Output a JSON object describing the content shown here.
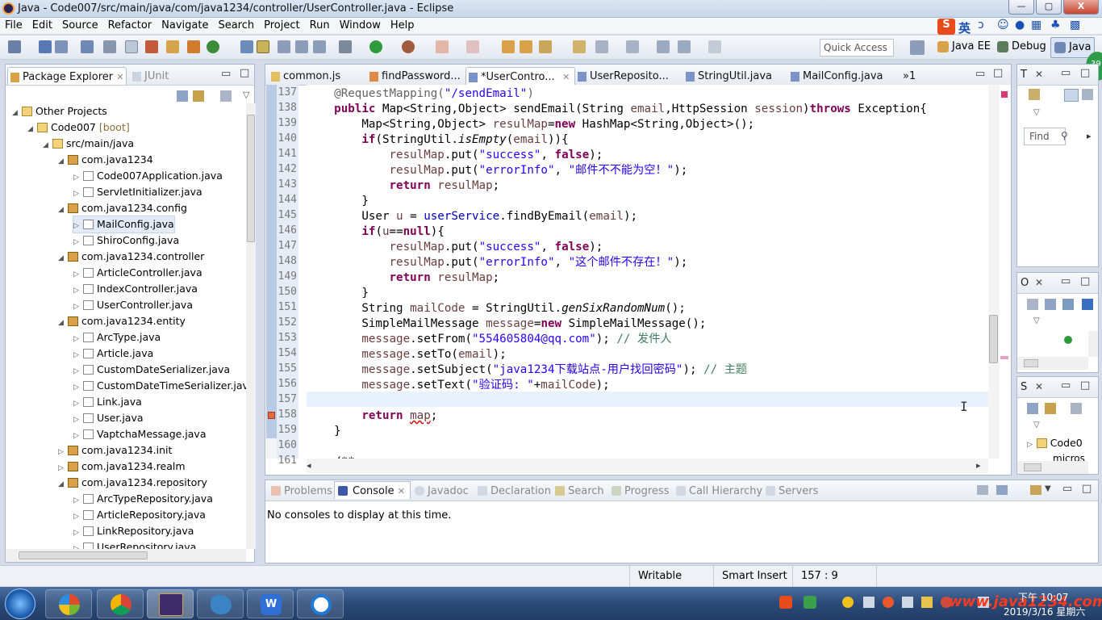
{
  "window": {
    "title": "Java - Code007/src/main/java/com/java1234/controller/UserController.java - Eclipse",
    "minimize": "—",
    "maximize": "▢",
    "close": "X"
  },
  "menu": [
    "File",
    "Edit",
    "Source",
    "Refactor",
    "Navigate",
    "Search",
    "Project",
    "Run",
    "Window",
    "Help"
  ],
  "quick_access": {
    "placeholder": "Quick Access"
  },
  "perspectives": [
    "Java EE",
    "Debug",
    "Java"
  ],
  "ime": {
    "label": "英"
  },
  "package_explorer": {
    "tabs": [
      "Package Explorer",
      "JUnit"
    ],
    "tree": [
      {
        "label": "Other Projects",
        "depth": 0,
        "twisty": "◢",
        "icon": "folder"
      },
      {
        "label": "Code007",
        "suffix": " [boot]",
        "depth": 1,
        "twisty": "◢",
        "icon": "project"
      },
      {
        "label": "src/main/java",
        "depth": 2,
        "twisty": "◢",
        "icon": "srcfolder"
      },
      {
        "label": "com.java1234",
        "depth": 3,
        "twisty": "◢",
        "icon": "package"
      },
      {
        "label": "Code007Application.java",
        "depth": 4,
        "twisty": "▷",
        "icon": "java"
      },
      {
        "label": "ServletInitializer.java",
        "depth": 4,
        "twisty": "▷",
        "icon": "java"
      },
      {
        "label": "com.java1234.config",
        "depth": 3,
        "twisty": "◢",
        "icon": "package"
      },
      {
        "label": "MailConfig.java",
        "depth": 4,
        "twisty": "▷",
        "icon": "java",
        "selected": true
      },
      {
        "label": "ShiroConfig.java",
        "depth": 4,
        "twisty": "▷",
        "icon": "java"
      },
      {
        "label": "com.java1234.controller",
        "depth": 3,
        "twisty": "◢",
        "icon": "package"
      },
      {
        "label": "ArticleController.java",
        "depth": 4,
        "twisty": "▷",
        "icon": "java"
      },
      {
        "label": "IndexController.java",
        "depth": 4,
        "twisty": "▷",
        "icon": "java"
      },
      {
        "label": "UserController.java",
        "depth": 4,
        "twisty": "▷",
        "icon": "java"
      },
      {
        "label": "com.java1234.entity",
        "depth": 3,
        "twisty": "◢",
        "icon": "package"
      },
      {
        "label": "ArcType.java",
        "depth": 4,
        "twisty": "▷",
        "icon": "java"
      },
      {
        "label": "Article.java",
        "depth": 4,
        "twisty": "▷",
        "icon": "java"
      },
      {
        "label": "CustomDateSerializer.java",
        "depth": 4,
        "twisty": "▷",
        "icon": "java"
      },
      {
        "label": "CustomDateTimeSerializer.java",
        "depth": 4,
        "twisty": "▷",
        "icon": "java"
      },
      {
        "label": "Link.java",
        "depth": 4,
        "twisty": "▷",
        "icon": "java"
      },
      {
        "label": "User.java",
        "depth": 4,
        "twisty": "▷",
        "icon": "java"
      },
      {
        "label": "VaptchaMessage.java",
        "depth": 4,
        "twisty": "▷",
        "icon": "java"
      },
      {
        "label": "com.java1234.init",
        "depth": 3,
        "twisty": "▷",
        "icon": "package"
      },
      {
        "label": "com.java1234.realm",
        "depth": 3,
        "twisty": "▷",
        "icon": "package"
      },
      {
        "label": "com.java1234.repository",
        "depth": 3,
        "twisty": "◢",
        "icon": "package"
      },
      {
        "label": "ArcTypeRepository.java",
        "depth": 4,
        "twisty": "▷",
        "icon": "java"
      },
      {
        "label": "ArticleRepository.java",
        "depth": 4,
        "twisty": "▷",
        "icon": "java"
      },
      {
        "label": "LinkRepository.java",
        "depth": 4,
        "twisty": "▷",
        "icon": "java"
      },
      {
        "label": "UserRepository.java",
        "depth": 4,
        "twisty": "▷",
        "icon": "java"
      }
    ]
  },
  "editor": {
    "tabs": [
      {
        "label": "common.js",
        "active": false,
        "icon": "js"
      },
      {
        "label": "findPassword...",
        "active": false,
        "icon": "html"
      },
      {
        "label": "*UserContro...",
        "active": true,
        "icon": "java"
      },
      {
        "label": "UserReposito...",
        "active": false,
        "icon": "java"
      },
      {
        "label": "StringUtil.java",
        "active": false,
        "icon": "java"
      },
      {
        "label": "MailConfig.java",
        "active": false,
        "icon": "java"
      }
    ],
    "overflow": "»1",
    "lines": [
      {
        "n": "137",
        "t": [
          [
            "an",
            "    @RequestMapping("
          ],
          [
            "st",
            "\"/sendEmail\""
          ],
          [
            "an",
            ")"
          ]
        ]
      },
      {
        "n": "138",
        "t": [
          [
            "",
            "    "
          ],
          [
            "kw",
            "public"
          ],
          [
            "",
            " Map<String,Object> sendEmail(String "
          ],
          [
            "lv",
            "email"
          ],
          [
            "",
            ",HttpSession "
          ],
          [
            "lv",
            "session"
          ],
          [
            "",
            ")"
          ],
          [
            "kw",
            "throws"
          ],
          [
            "",
            " Exception{"
          ]
        ]
      },
      {
        "n": "139",
        "t": [
          [
            "",
            "        Map<String,Object> "
          ],
          [
            "lv",
            "resulMap"
          ],
          [
            "",
            "="
          ],
          [
            "kw",
            "new"
          ],
          [
            "",
            " HashMap<String,Object>();"
          ]
        ]
      },
      {
        "n": "140",
        "t": [
          [
            "",
            "        "
          ],
          [
            "kw",
            "if"
          ],
          [
            "",
            "(StringUtil."
          ],
          [
            "it",
            "isEmpty"
          ],
          [
            "",
            "("
          ],
          [
            "lv",
            "email"
          ],
          [
            "",
            ")){"
          ]
        ]
      },
      {
        "n": "141",
        "t": [
          [
            "",
            "            "
          ],
          [
            "lv",
            "resulMap"
          ],
          [
            "",
            ".put("
          ],
          [
            "st",
            "\"success\""
          ],
          [
            "",
            ", "
          ],
          [
            "kw",
            "false"
          ],
          [
            "",
            ");"
          ]
        ]
      },
      {
        "n": "142",
        "t": [
          [
            "",
            "            "
          ],
          [
            "lv",
            "resulMap"
          ],
          [
            "",
            ".put("
          ],
          [
            "st",
            "\"errorInfo\""
          ],
          [
            "",
            ", "
          ],
          [
            "st",
            "\"邮件不不能为空！\""
          ],
          [
            "",
            ");"
          ]
        ]
      },
      {
        "n": "143",
        "t": [
          [
            "",
            "            "
          ],
          [
            "kw",
            "return"
          ],
          [
            "",
            " "
          ],
          [
            "lv",
            "resulMap"
          ],
          [
            "",
            ";"
          ]
        ]
      },
      {
        "n": "144",
        "t": [
          [
            "",
            "        }"
          ]
        ]
      },
      {
        "n": "145",
        "t": [
          [
            "",
            "        User "
          ],
          [
            "lv",
            "u"
          ],
          [
            "",
            " = "
          ],
          [
            "fd",
            "userService"
          ],
          [
            "",
            ".findByEmail("
          ],
          [
            "lv",
            "email"
          ],
          [
            "",
            ");"
          ]
        ]
      },
      {
        "n": "146",
        "t": [
          [
            "",
            "        "
          ],
          [
            "kw",
            "if"
          ],
          [
            "",
            "("
          ],
          [
            "lv",
            "u"
          ],
          [
            "",
            "=="
          ],
          [
            "kw",
            "null"
          ],
          [
            "",
            "){"
          ]
        ]
      },
      {
        "n": "147",
        "t": [
          [
            "",
            "            "
          ],
          [
            "lv",
            "resulMap"
          ],
          [
            "",
            ".put("
          ],
          [
            "st",
            "\"success\""
          ],
          [
            "",
            ", "
          ],
          [
            "kw",
            "false"
          ],
          [
            "",
            ");"
          ]
        ]
      },
      {
        "n": "148",
        "t": [
          [
            "",
            "            "
          ],
          [
            "lv",
            "resulMap"
          ],
          [
            "",
            ".put("
          ],
          [
            "st",
            "\"errorInfo\""
          ],
          [
            "",
            ", "
          ],
          [
            "st",
            "\"这个邮件不存在！\""
          ],
          [
            "",
            ");"
          ]
        ]
      },
      {
        "n": "149",
        "t": [
          [
            "",
            "            "
          ],
          [
            "kw",
            "return"
          ],
          [
            "",
            " "
          ],
          [
            "lv",
            "resulMap"
          ],
          [
            "",
            ";"
          ]
        ]
      },
      {
        "n": "150",
        "t": [
          [
            "",
            "        }"
          ]
        ]
      },
      {
        "n": "151",
        "t": [
          [
            "",
            "        String "
          ],
          [
            "lv",
            "mailCode"
          ],
          [
            "",
            " = StringUtil."
          ],
          [
            "it",
            "genSixRandomNum"
          ],
          [
            "",
            "();"
          ]
        ]
      },
      {
        "n": "152",
        "t": [
          [
            "",
            "        SimpleMailMessage "
          ],
          [
            "lv",
            "message"
          ],
          [
            "",
            "="
          ],
          [
            "kw",
            "new"
          ],
          [
            "",
            " SimpleMailMessage();"
          ]
        ]
      },
      {
        "n": "153",
        "t": [
          [
            "",
            "        "
          ],
          [
            "lv",
            "message"
          ],
          [
            "",
            ".setFrom("
          ],
          [
            "st",
            "\"554605804@qq.com\""
          ],
          [
            "",
            "); "
          ],
          [
            "cm",
            "// 发件人"
          ]
        ]
      },
      {
        "n": "154",
        "t": [
          [
            "",
            "        "
          ],
          [
            "lv",
            "message"
          ],
          [
            "",
            ".setTo("
          ],
          [
            "lv",
            "email"
          ],
          [
            "",
            ");"
          ]
        ]
      },
      {
        "n": "155",
        "t": [
          [
            "",
            "        "
          ],
          [
            "lv",
            "message"
          ],
          [
            "",
            ".setSubject("
          ],
          [
            "st",
            "\"java1234下载站点-用户找回密码\""
          ],
          [
            "",
            "); "
          ],
          [
            "cm",
            "// 主题"
          ]
        ]
      },
      {
        "n": "156",
        "t": [
          [
            "",
            "        "
          ],
          [
            "lv",
            "message"
          ],
          [
            "",
            ".setText("
          ],
          [
            "st",
            "\"验证码: \""
          ],
          [
            "",
            "+"
          ],
          [
            "lv",
            "mailCode"
          ],
          [
            "",
            ");"
          ]
        ]
      },
      {
        "n": "157",
        "t": [
          [
            "",
            ""
          ]
        ]
      },
      {
        "n": "158",
        "t": [
          [
            "",
            "        "
          ],
          [
            "kw",
            "return"
          ],
          [
            "",
            " "
          ],
          [
            "lv",
            "map"
          ],
          [
            "",
            ";"
          ]
        ]
      },
      {
        "n": "159",
        "t": [
          [
            "",
            "    }"
          ]
        ]
      },
      {
        "n": "160",
        "t": [
          [
            "",
            ""
          ]
        ]
      },
      {
        "n": "161",
        "t": [
          [
            "",
            "    /**"
          ]
        ]
      }
    ]
  },
  "outline_panels": [
    {
      "tab": "T",
      "find_placeholder": "Find"
    },
    {
      "tab": "O"
    },
    {
      "tab": "S",
      "item": "Code0",
      "item2": "micros"
    }
  ],
  "console": {
    "tabs": [
      "Problems",
      "Console",
      "Javadoc",
      "Declaration",
      "Search",
      "Progress",
      "Call Hierarchy",
      "Servers"
    ],
    "message": "No consoles to display at this time."
  },
  "status": {
    "writable": "Writable",
    "insert_mode": "Smart Insert",
    "position": "157 : 9"
  },
  "taskbar": {
    "apps": [
      "start",
      "windows",
      "chrome",
      "eclipse",
      "dolphin",
      "wps",
      "camera"
    ],
    "tray_time": "下午 10:07",
    "tray_date": "2019/3/16 星期六",
    "watermark": "www.java1234.com"
  }
}
